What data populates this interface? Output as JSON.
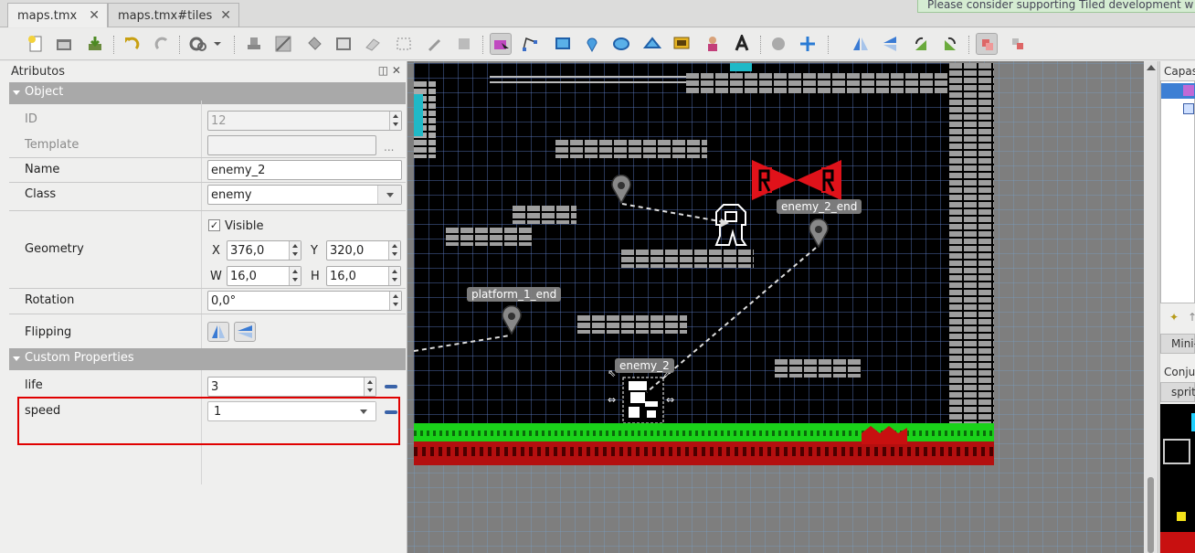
{
  "tabs": [
    {
      "label": "maps.tmx",
      "close": "✕"
    },
    {
      "label": "maps.tmx#tiles",
      "close": "✕"
    }
  ],
  "notice": "Please consider supporting Tiled development w",
  "properties_panel": {
    "title": "Atributos",
    "header_buttons": "◫ ✕",
    "object_group": "Object",
    "id_label": "ID",
    "id_value": "12",
    "template_label": "Template",
    "template_value": "",
    "template_dots": "...",
    "name_label": "Name",
    "name_value": "enemy_2",
    "class_label": "Class",
    "class_value": "enemy",
    "visible_label": "Visible",
    "visible_check": "✓",
    "geometry_label": "Geometry",
    "x_label": "X",
    "x_value": "376,0",
    "y_label": "Y",
    "y_value": "320,0",
    "w_label": "W",
    "w_value": "16,0",
    "h_label": "H",
    "h_value": "16,0",
    "rotation_label": "Rotation",
    "rotation_value": "0,0°",
    "flipping_label": "Flipping",
    "custom_group": "Custom Properties",
    "life_label": "life",
    "life_value": "3",
    "speed_label": "speed",
    "speed_value": "1"
  },
  "map": {
    "labels": {
      "enemy_2_end": "enemy_2_end",
      "platform_1_end": "platform_1_end",
      "enemy_2": "enemy_2"
    }
  },
  "right_panel": {
    "layers_title": "Capas",
    "minimap_tab": "Mini-",
    "tilesets_title": "Conju",
    "tileset_tab": "sprit"
  },
  "colors": {
    "accent_blue": "#3a63a8",
    "highlight_red": "#e00000",
    "grass": "#1ad11a",
    "lava": "#b40f0f",
    "brick": "#9e9e9e"
  }
}
